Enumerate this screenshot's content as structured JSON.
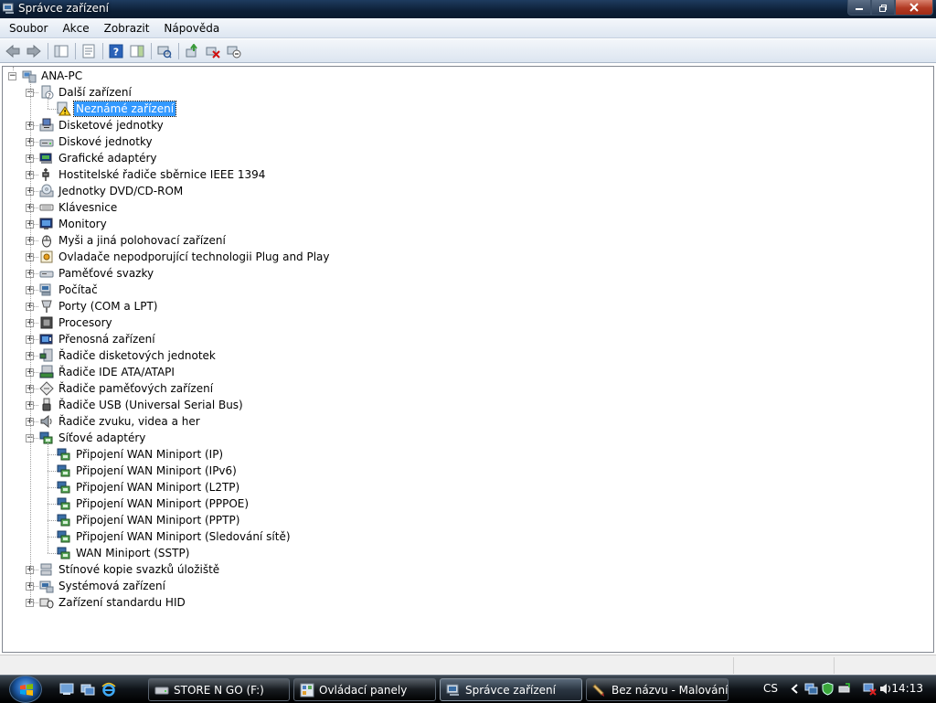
{
  "window": {
    "title": "Správce zařízení"
  },
  "menu": [
    "Soubor",
    "Akce",
    "Zobrazit",
    "Nápověda"
  ],
  "tree": {
    "root": "ANA-PC",
    "nodes": [
      {
        "label": "Další zařízení",
        "icon": "unknown-device-icon",
        "expanded": true,
        "children": [
          {
            "label": "Neznámé zařízení",
            "icon": "warning-icon",
            "selected": true
          }
        ]
      },
      {
        "label": "Disketové jednotky",
        "icon": "floppy-drive-icon"
      },
      {
        "label": "Diskové jednotky",
        "icon": "disk-drive-icon"
      },
      {
        "label": "Grafické adaptéry",
        "icon": "display-adapter-icon"
      },
      {
        "label": "Hostitelské řadiče sběrnice IEEE 1394",
        "icon": "ieee1394-icon"
      },
      {
        "label": "Jednotky DVD/CD-ROM",
        "icon": "dvd-drive-icon"
      },
      {
        "label": "Klávesnice",
        "icon": "keyboard-icon"
      },
      {
        "label": "Monitory",
        "icon": "monitor-icon"
      },
      {
        "label": "Myši a jiná polohovací zařízení",
        "icon": "mouse-icon"
      },
      {
        "label": "Ovladače nepodporující technologii Plug and Play",
        "icon": "non-pnp-driver-icon"
      },
      {
        "label": "Paměťové svazky",
        "icon": "storage-volume-icon"
      },
      {
        "label": "Počítač",
        "icon": "computer-icon"
      },
      {
        "label": "Porty (COM a LPT)",
        "icon": "port-icon"
      },
      {
        "label": "Procesory",
        "icon": "processor-icon"
      },
      {
        "label": "Přenosná zařízení",
        "icon": "portable-device-icon"
      },
      {
        "label": "Řadiče disketových jednotek",
        "icon": "floppy-controller-icon"
      },
      {
        "label": "Řadiče IDE ATA/ATAPI",
        "icon": "ide-controller-icon"
      },
      {
        "label": "Řadiče paměťových zařízení",
        "icon": "storage-controller-icon"
      },
      {
        "label": "Řadiče USB (Universal Serial Bus)",
        "icon": "usb-icon"
      },
      {
        "label": "Řadiče zvuku, videa a her",
        "icon": "speaker-icon"
      },
      {
        "label": "Síťové adaptéry",
        "icon": "network-adapter-icon",
        "expanded": true,
        "children": [
          {
            "label": "Připojení WAN Miniport (IP)",
            "icon": "network-adapter-icon"
          },
          {
            "label": "Připojení WAN Miniport (IPv6)",
            "icon": "network-adapter-icon"
          },
          {
            "label": "Připojení WAN Miniport (L2TP)",
            "icon": "network-adapter-icon"
          },
          {
            "label": "Připojení WAN Miniport (PPPOE)",
            "icon": "network-adapter-icon"
          },
          {
            "label": "Připojení WAN Miniport (PPTP)",
            "icon": "network-adapter-icon"
          },
          {
            "label": "Připojení WAN Miniport (Sledování sítě)",
            "icon": "network-adapter-icon"
          },
          {
            "label": "WAN Miniport (SSTP)",
            "icon": "network-adapter-icon"
          }
        ]
      },
      {
        "label": "Stínové kopie svazků úložiště",
        "icon": "shadow-copy-icon"
      },
      {
        "label": "Systémová zařízení",
        "icon": "system-device-icon"
      },
      {
        "label": "Zařízení standardu HID",
        "icon": "hid-icon"
      }
    ]
  },
  "taskbar": {
    "tasks": [
      {
        "label": "STORE N GO (F:)",
        "icon": "drive-icon",
        "active": false
      },
      {
        "label": "Ovládací panely",
        "icon": "control-panel-icon",
        "active": false
      },
      {
        "label": "Správce zařízení",
        "icon": "device-manager-icon",
        "active": true
      },
      {
        "label": "Bez názvu - Malování",
        "icon": "paint-icon",
        "active": false
      }
    ],
    "language": "CS",
    "clock": "14:13"
  },
  "colors": {
    "selection": "#3399ff",
    "titlebar": "#0d1f36"
  }
}
